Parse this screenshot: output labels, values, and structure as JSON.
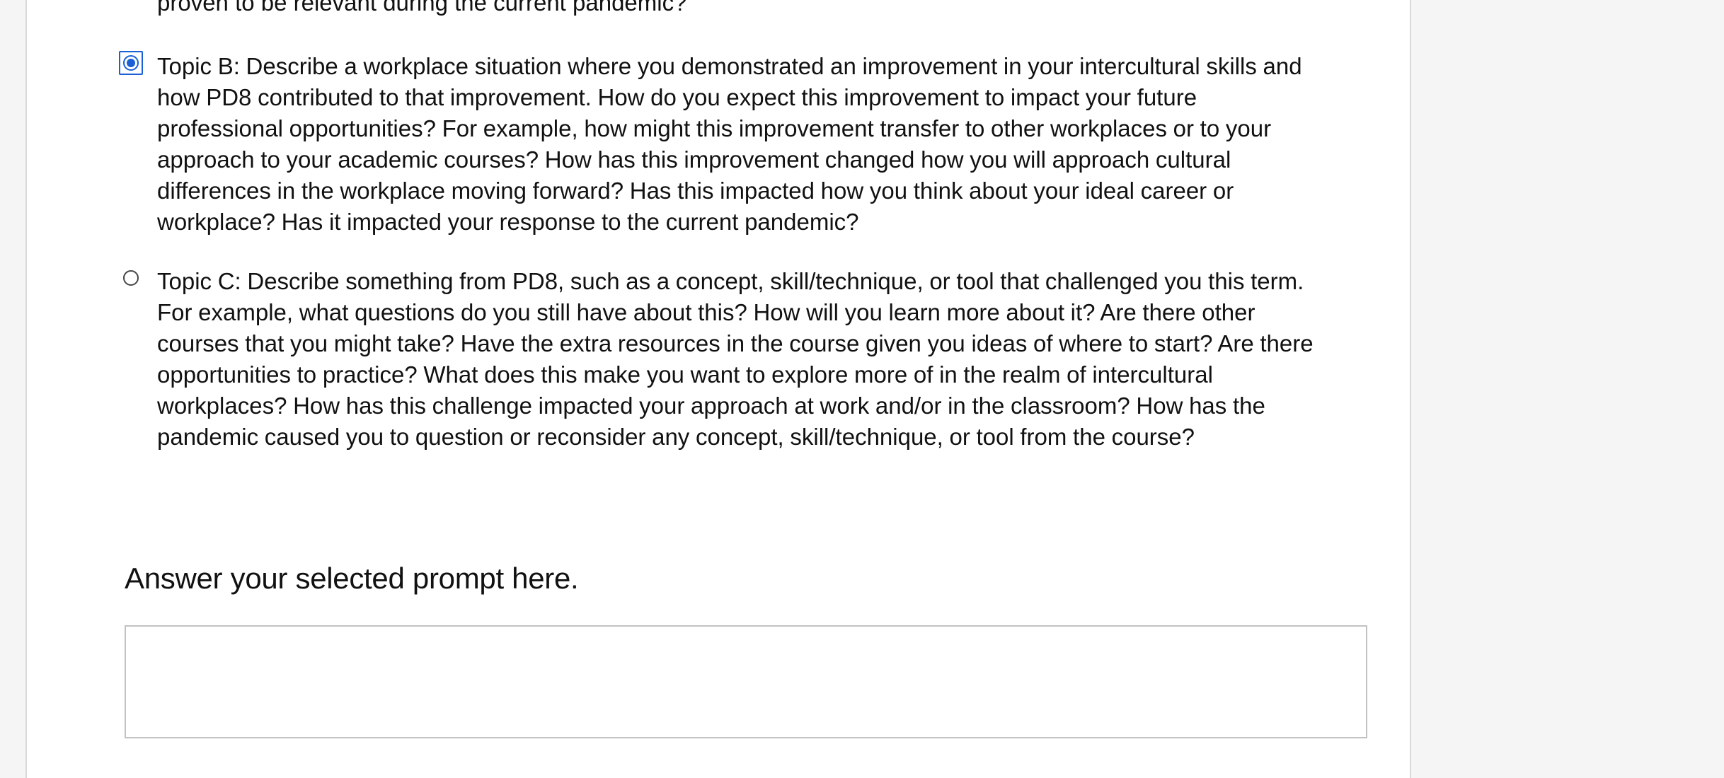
{
  "previous_option": {
    "text_tail": "proven to be relevant during the current pandemic?"
  },
  "prompt_options": [
    {
      "label": "Topic B: Describe a workplace situation where you demonstrated an improvement in your intercultural skills and\nhow PD8 contributed to that improvement. How do you expect this improvement to impact your future\nprofessional opportunities? For example, how might this improvement transfer to other workplaces or to your\napproach to your academic courses? How has this improvement changed how you will approach cultural\ndifferences in the workplace moving forward? Has this impacted how you think about your ideal career or\nworkplace? Has it impacted your response to the current pandemic?",
      "selected": true
    },
    {
      "label": "Topic C: Describe something from PD8, such as a concept, skill/technique, or tool that challenged you this term.\nFor example, what questions do you still have about this? How will you learn more about it? Are there other\ncourses that you might take? Have the extra resources in the course given you ideas of where to start? Are there\nopportunities to practice? What does this make you want to explore more of in the realm of intercultural\nworkplaces? How has this challenge impacted your approach at work and/or in the classroom? How has the\npandemic caused you to question or reconsider any concept, skill/technique, or tool from the course?",
      "selected": false
    }
  ],
  "answer": {
    "heading": "Answer your selected prompt here.",
    "value": ""
  },
  "colors": {
    "accent": "#1a5fd6",
    "page_background": "#f5f5f5",
    "panel_background": "#ffffff",
    "text": "#111111"
  }
}
